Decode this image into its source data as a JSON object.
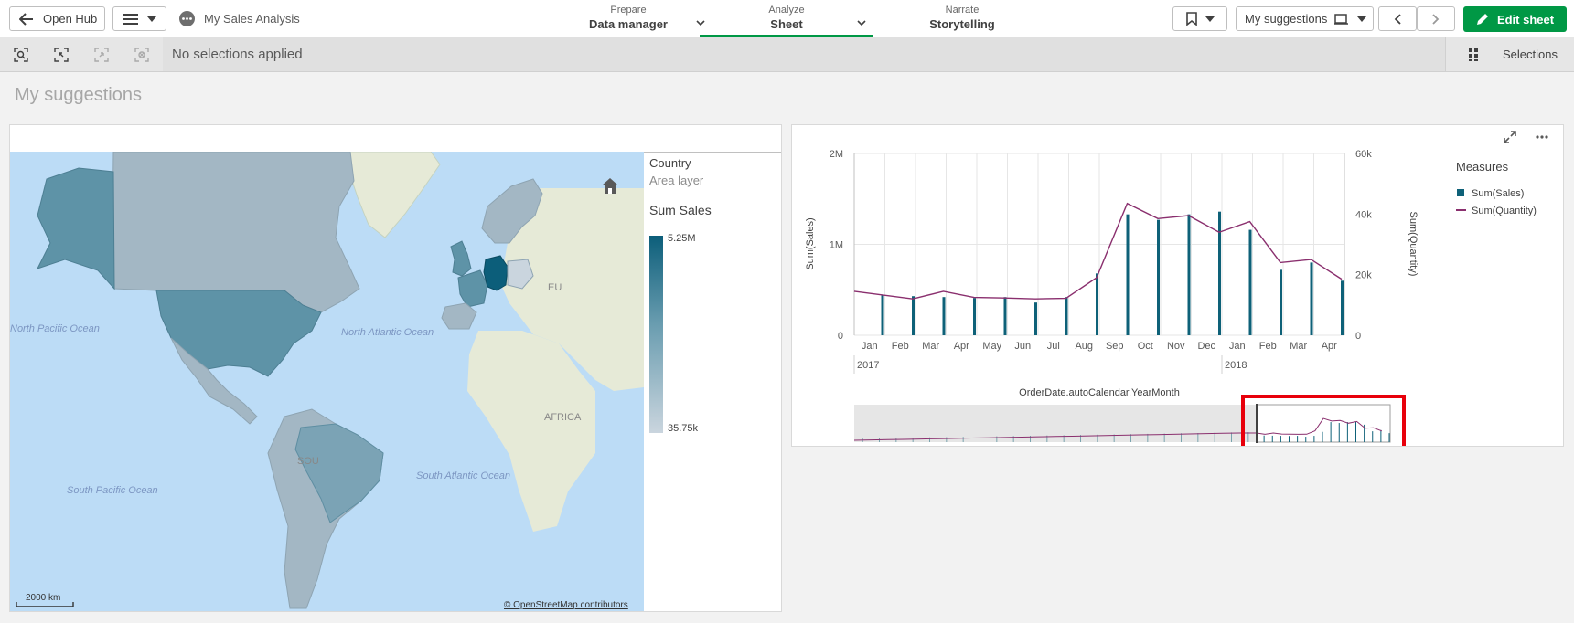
{
  "topbar": {
    "open_hub": "Open Hub",
    "app_name": "My Sales Analysis",
    "tabs": [
      {
        "small": "Prepare",
        "big": "Data manager"
      },
      {
        "small": "Analyze",
        "big": "Sheet"
      },
      {
        "small": "Narrate",
        "big": "Storytelling"
      }
    ],
    "sheet_selector": "My suggestions",
    "edit_sheet": "Edit sheet"
  },
  "selections": {
    "status": "No selections applied",
    "button": "Selections"
  },
  "sheet": {
    "title": "My suggestions"
  },
  "map": {
    "legend_title": "Country",
    "legend_subtitle": "Area layer",
    "measure_title": "Sum Sales",
    "max_label": "5.25M",
    "min_label": "35.75k",
    "labels": {
      "north_pacific": "North Pacific Ocean",
      "north_atlantic": "North Atlantic Ocean",
      "south_pacific": "South Pacific Ocean",
      "south_atlantic": "South Atlantic Ocean",
      "africa": "AFRICA",
      "sou": "SOU",
      "eu": "EU"
    },
    "scale": "2000 km",
    "attribution": "© OpenStreetMap contributors",
    "colors": {
      "sea": "#bcdcf6",
      "land": "#e6ead7",
      "high": "#0c5e7a",
      "low": "#cad5de"
    }
  },
  "chart_data": {
    "type": "bar",
    "categories": [
      "Jan",
      "Feb",
      "Mar",
      "Apr",
      "May",
      "Jun",
      "Jul",
      "Aug",
      "Sep",
      "Oct",
      "Nov",
      "Dec",
      "Jan",
      "Feb",
      "Mar",
      "Apr"
    ],
    "year_labels": [
      {
        "label": "2017",
        "index": 0
      },
      {
        "label": "2018",
        "index": 12
      }
    ],
    "xlabel": "OrderDate.autoCalendar.YearMonth",
    "ylabel": "Sum(Sales)",
    "y2label": "Sum(Quantity)",
    "ylim": [
      0,
      2000000
    ],
    "y2lim": [
      0,
      60000
    ],
    "yticks": [
      "0",
      "1M",
      "2M"
    ],
    "y2ticks": [
      "0",
      "20k",
      "40k",
      "60k"
    ],
    "legend_title": "Measures",
    "series": [
      {
        "name": "Sum(Sales)",
        "type": "bar",
        "color": "#0e6178",
        "values": [
          440000,
          430000,
          420000,
          410000,
          420000,
          360000,
          420000,
          680000,
          1330000,
          1270000,
          1330000,
          1360000,
          1160000,
          720000,
          800000,
          600000
        ]
      },
      {
        "name": "Sum(Quantity)",
        "type": "line",
        "color": "#8a2f6e",
        "values": [
          14500,
          12000,
          14500,
          12500,
          12300,
          12000,
          12200,
          19000,
          43500,
          38500,
          39500,
          34000,
          37500,
          24000,
          25000,
          18500
        ]
      }
    ],
    "minimap": {
      "window_highlighted": true,
      "highlight_color": "#e8000b"
    }
  }
}
